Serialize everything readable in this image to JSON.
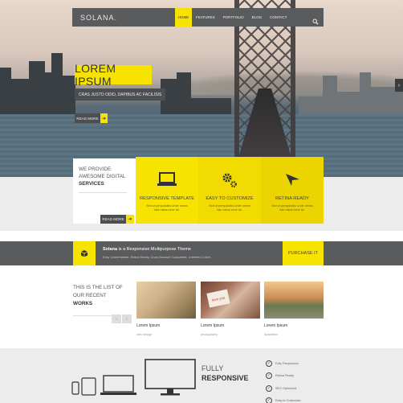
{
  "nav": {
    "logo": "SOLANA",
    "logo_dot": ".",
    "items": [
      "HOME",
      "FEATURES",
      "PORTFOLIO",
      "BLOG",
      "CONTACT"
    ],
    "search_icon": "search-icon"
  },
  "hero": {
    "title": "LOREM IPSUM",
    "subtitle": "CRAS JUSTO ODIO, DAPIBUS AC FACILISIS",
    "button": "READ MORE",
    "button_arrow": "➔",
    "next_arrow": "›"
  },
  "intro": {
    "line1": "WE PROVIDE",
    "line2": "AWESOME DIGITAL",
    "line3": "SERVICES",
    "button": "READ MORE",
    "button_arrow": "➔"
  },
  "features": [
    {
      "title": "RESPONSIVE TEMPLATE",
      "icon": "laptop-icon",
      "desc": "Sed ut perspiciatis unde omnis iste natus error sit."
    },
    {
      "title": "EASY TO CUSTOMIZE",
      "icon": "gears-icon",
      "desc": "Sed ut perspiciatis unde omnis iste natus error sit."
    },
    {
      "title": "RETINA READY",
      "icon": "paper-plane-icon",
      "desc": "Sed ut perspiciatis unde omnis iste natus error sit."
    }
  ],
  "strip": {
    "brand": "Solana",
    "text": " is a Responsive Multipurpose Theme",
    "small": "Easy Customizable, Retina Ready, Cross Browser Compatible, Unlimited Colors",
    "purchase": "PURCHASE IT",
    "icon": "box-icon"
  },
  "recent": {
    "line1": "THIS IS THE LIST OF",
    "line2": "OUR RECENT",
    "line3": "WORKS",
    "prev": "‹",
    "next": "›",
    "items": [
      {
        "caption": "Lorem Ipsum",
        "category": "web design"
      },
      {
        "caption": "Lorem Ipsum",
        "category": "photography",
        "note": "love you"
      },
      {
        "caption": "Lorem Ipsum",
        "category": "illustration"
      }
    ]
  },
  "responsive": {
    "line1": "FULLY",
    "line2": "RESPONSIVE",
    "checks": [
      "Fully Responsive",
      "Retina Ready",
      "SEO Optimized",
      "Easy to Customize"
    ],
    "check_glyph": "✓"
  },
  "colors": {
    "accent": "#f6e300",
    "dark": "#5a5b5d"
  }
}
